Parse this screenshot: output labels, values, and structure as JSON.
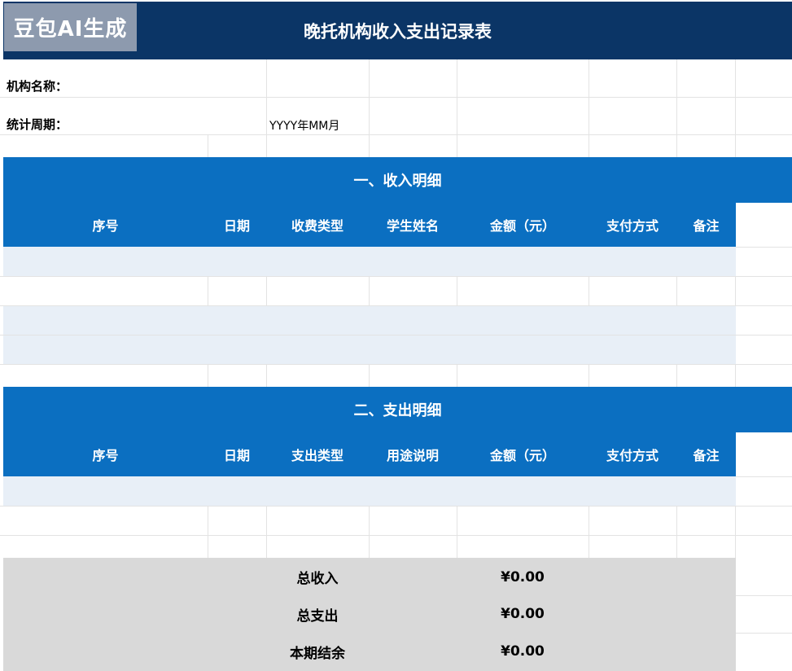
{
  "title": "晚托机构收入支出记录表",
  "watermark": "豆包AI生成",
  "info": {
    "org_name_label": "机构名称：",
    "period_label": "统计周期：",
    "period_value": "YYYY年MM月"
  },
  "income": {
    "section_title": "一、收入明细",
    "headers": [
      "序号",
      "日期",
      "收费类型",
      "学生姓名",
      "金额（元）",
      "支付方式",
      "备注"
    ]
  },
  "expense": {
    "section_title": "二、支出明细",
    "headers": [
      "序号",
      "日期",
      "支出类型",
      "用途说明",
      "金额（元）",
      "支付方式",
      "备注"
    ]
  },
  "summary": [
    {
      "label": "总收入",
      "value": "¥0.00"
    },
    {
      "label": "总支出",
      "value": "¥0.00"
    },
    {
      "label": "本期结余",
      "value": "¥0.00"
    }
  ],
  "colors": {
    "title_bar": "#0b3566",
    "section_bar": "#0b6fc1",
    "alt_row": "#e8eff7",
    "summary_bg": "#d9d9d9"
  }
}
